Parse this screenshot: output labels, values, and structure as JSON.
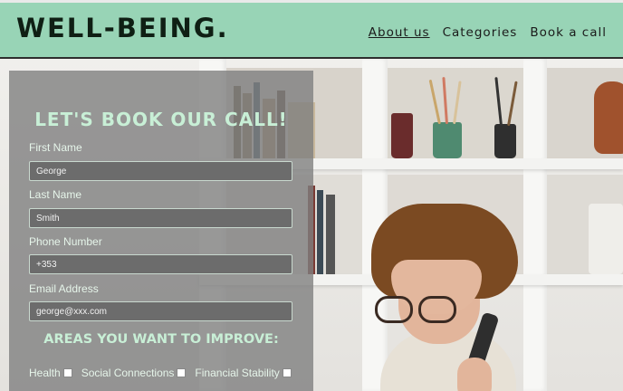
{
  "header": {
    "logo": "WELL-BEING.",
    "nav": [
      {
        "label": "About us",
        "active": true
      },
      {
        "label": "Categories",
        "active": false
      },
      {
        "label": "Book a call",
        "active": false
      }
    ]
  },
  "form": {
    "title": "LET'S BOOK OUR CALL!",
    "fields": [
      {
        "label": "First Name",
        "value": "George"
      },
      {
        "label": "Last Name",
        "value": "Smith"
      },
      {
        "label": "Phone Number",
        "value": "+353"
      },
      {
        "label": "Email Address",
        "value": "george@xxx.com"
      }
    ],
    "areas_title": "AREAS YOU WANT TO IMPROVE:",
    "areas": [
      {
        "label": "Health",
        "checked": false
      },
      {
        "label": "Social Connections",
        "checked": false
      },
      {
        "label": "Financial Stability",
        "checked": false
      }
    ]
  },
  "colors": {
    "header_bg": "#98d4b6",
    "accent_text": "#c8efd6",
    "panel_bg": "rgba(128,128,128,0.80)"
  }
}
